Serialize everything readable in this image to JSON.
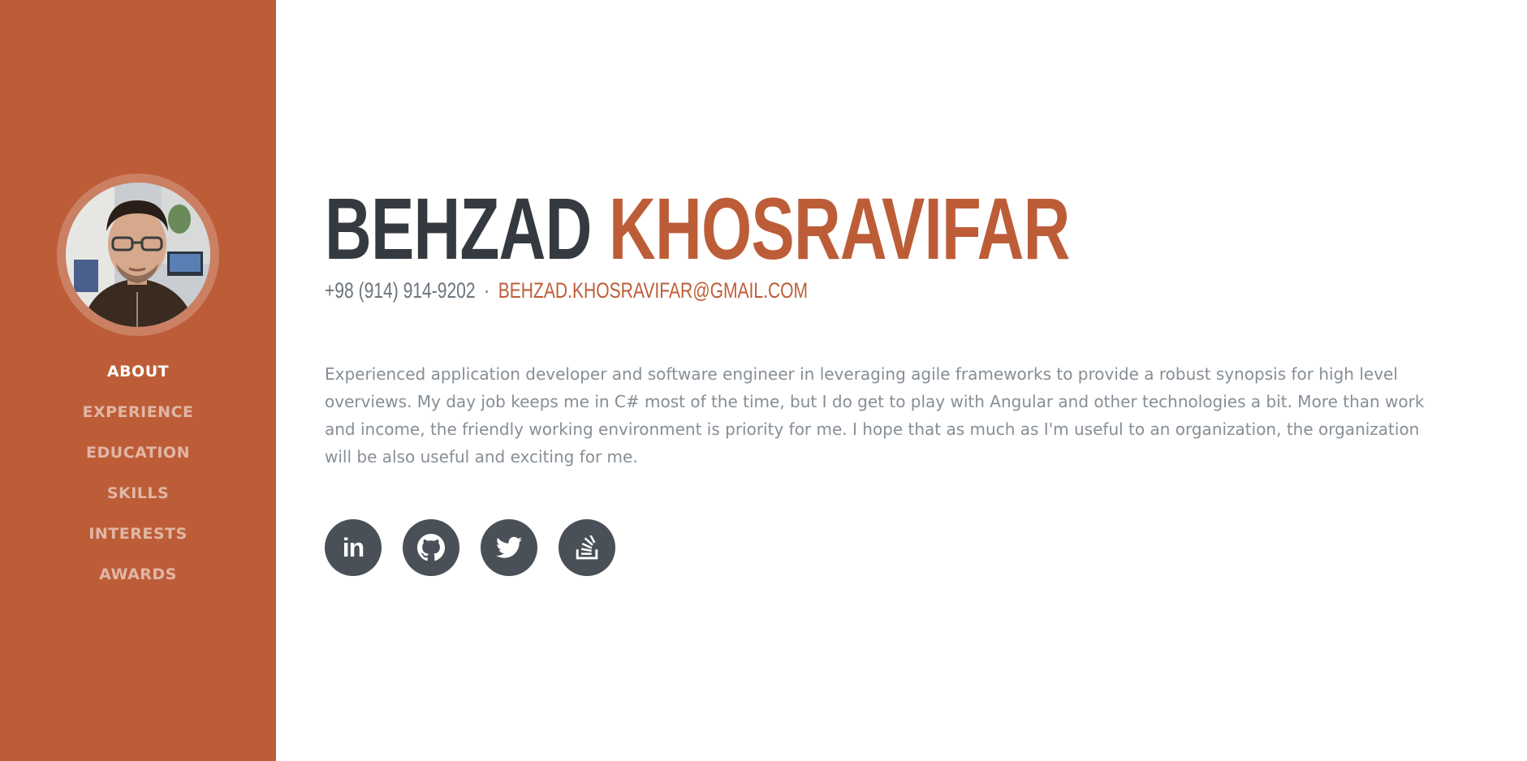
{
  "theme": {
    "accent": "#bd5d38",
    "dark": "#343a40",
    "muted": "#868e96",
    "social_bg": "#495057"
  },
  "sidebar": {
    "nav": [
      {
        "label": "ABOUT",
        "active": true
      },
      {
        "label": "EXPERIENCE",
        "active": false
      },
      {
        "label": "EDUCATION",
        "active": false
      },
      {
        "label": "SKILLS",
        "active": false
      },
      {
        "label": "INTERESTS",
        "active": false
      },
      {
        "label": "AWARDS",
        "active": false
      }
    ]
  },
  "about": {
    "first_name": "BEHZAD",
    "last_name": "KHOSRAVIFAR",
    "phone": "+98 (914) 914-9202",
    "separator": "·",
    "email": "BEHZAD.KHOSRAVIFAR@GMAIL.COM",
    "bio": "Experienced application developer and software engineer in leveraging agile frameworks to provide a robust synopsis for high level overviews. My day job keeps me in C# most of the time, but I do get to play with Angular and other technologies a bit. More than work and income, the friendly working environment is priority for me. I hope that as much as I'm useful to an organization, the organization will be also useful and exciting for me.",
    "social": [
      {
        "icon": "linkedin-icon",
        "glyph": "in"
      },
      {
        "icon": "github-icon"
      },
      {
        "icon": "twitter-icon"
      },
      {
        "icon": "stackoverflow-icon"
      }
    ]
  }
}
